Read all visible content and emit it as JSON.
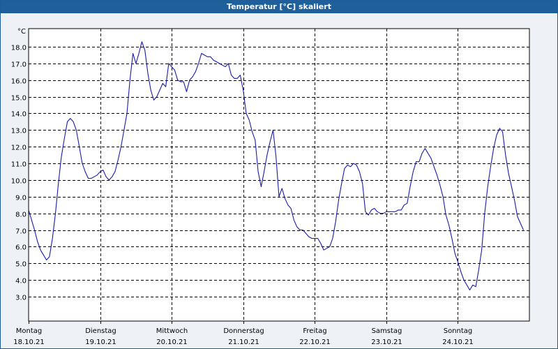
{
  "window": {
    "title": "Temperatur [°C] skaliert"
  },
  "colors": {
    "title_bg": "#1f5f9a",
    "plot_bg": "#ffffff",
    "series": "#1a1aa8",
    "grid": "#000000"
  },
  "chart_data": {
    "type": "line",
    "title": "Temperatur [°C] skaliert",
    "ylabel": "°C",
    "xlabel": "",
    "ylim": [
      2.5,
      18.8
    ],
    "xlim": [
      0,
      168
    ],
    "grid": true,
    "y_ticks": [
      "3.0",
      "4.0",
      "5.0",
      "6.0",
      "7.0",
      "8.0",
      "9.0",
      "10.0",
      "11.0",
      "12.0",
      "13.0",
      "14.0",
      "15.0",
      "16.0",
      "17.0",
      "18.0"
    ],
    "x_ticks": [
      {
        "day": "Montag",
        "date": "18.10.21",
        "x": 0
      },
      {
        "day": "Dienstag",
        "date": "19.10.21",
        "x": 24
      },
      {
        "day": "Mittwoch",
        "date": "20.10.21",
        "x": 48
      },
      {
        "day": "Donnerstag",
        "date": "21.10.21",
        "x": 72
      },
      {
        "day": "Freitag",
        "date": "22.10.21",
        "x": 96
      },
      {
        "day": "Samstag",
        "date": "23.10.21",
        "x": 120
      },
      {
        "day": "Sonntag",
        "date": "24.10.21",
        "x": 144
      }
    ],
    "series": [
      {
        "values": [
          [
            0.0,
            8.2
          ],
          [
            1.0,
            7.6
          ],
          [
            2.0,
            7.0
          ],
          [
            3.0,
            6.3
          ],
          [
            4.0,
            5.8
          ],
          [
            5.0,
            5.5
          ],
          [
            6.0,
            5.2
          ],
          [
            7.0,
            5.4
          ],
          [
            8.0,
            6.5
          ],
          [
            9.0,
            8.0
          ],
          [
            10.0,
            9.8
          ],
          [
            11.0,
            11.4
          ],
          [
            12.0,
            12.5
          ],
          [
            13.0,
            13.5
          ],
          [
            14.0,
            13.7
          ],
          [
            15.0,
            13.5
          ],
          [
            16.0,
            13.0
          ],
          [
            17.0,
            12.0
          ],
          [
            18.0,
            11.0
          ],
          [
            19.0,
            10.5
          ],
          [
            20.0,
            10.1
          ],
          [
            21.0,
            10.1
          ],
          [
            22.0,
            10.2
          ],
          [
            23.0,
            10.3
          ],
          [
            24.0,
            10.5
          ],
          [
            25.0,
            10.6
          ],
          [
            26.0,
            10.2
          ],
          [
            27.0,
            10.0
          ],
          [
            28.0,
            10.2
          ],
          [
            29.0,
            10.5
          ],
          [
            30.0,
            11.2
          ],
          [
            31.0,
            12.0
          ],
          [
            32.0,
            13.0
          ],
          [
            33.0,
            14.0
          ],
          [
            34.0,
            16.0
          ],
          [
            35.0,
            17.6
          ],
          [
            36.0,
            17.0
          ],
          [
            37.0,
            17.6
          ],
          [
            38.0,
            18.3
          ],
          [
            39.0,
            17.8
          ],
          [
            40.0,
            16.4
          ],
          [
            41.0,
            15.4
          ],
          [
            42.0,
            14.8
          ],
          [
            43.0,
            15.0
          ],
          [
            44.0,
            15.4
          ],
          [
            45.0,
            15.8
          ],
          [
            46.0,
            15.6
          ],
          [
            47.0,
            17.0
          ],
          [
            48.0,
            16.8
          ],
          [
            49.0,
            16.6
          ],
          [
            50.0,
            16.0
          ],
          [
            51.0,
            15.9
          ],
          [
            52.0,
            15.9
          ],
          [
            53.0,
            15.3
          ],
          [
            54.0,
            16.0
          ],
          [
            55.0,
            16.2
          ],
          [
            56.0,
            16.5
          ],
          [
            57.0,
            17.0
          ],
          [
            58.0,
            17.6
          ],
          [
            59.0,
            17.5
          ],
          [
            60.0,
            17.4
          ],
          [
            61.0,
            17.4
          ],
          [
            62.0,
            17.2
          ],
          [
            63.0,
            17.1
          ],
          [
            64.0,
            17.0
          ],
          [
            65.0,
            16.9
          ],
          [
            66.0,
            16.8
          ],
          [
            67.0,
            17.0
          ],
          [
            68.0,
            16.3
          ],
          [
            69.0,
            16.1
          ],
          [
            70.0,
            16.1
          ],
          [
            71.0,
            16.3
          ],
          [
            72.0,
            15.4
          ],
          [
            73.0,
            14.0
          ],
          [
            74.0,
            13.6
          ],
          [
            75.0,
            12.9
          ],
          [
            76.0,
            12.4
          ],
          [
            77.0,
            10.5
          ],
          [
            78.0,
            9.6
          ],
          [
            79.0,
            10.5
          ],
          [
            80.0,
            11.5
          ],
          [
            81.0,
            12.3
          ],
          [
            82.0,
            13.0
          ],
          [
            83.0,
            11.4
          ],
          [
            84.0,
            9.0
          ],
          [
            85.0,
            9.5
          ],
          [
            86.0,
            8.9
          ],
          [
            87.0,
            8.5
          ],
          [
            88.0,
            8.3
          ],
          [
            89.0,
            7.6
          ],
          [
            90.0,
            7.2
          ],
          [
            91.0,
            7.0
          ],
          [
            92.0,
            7.0
          ],
          [
            93.0,
            6.8
          ],
          [
            94.0,
            6.6
          ],
          [
            95.0,
            6.5
          ],
          [
            96.0,
            6.5
          ],
          [
            97.0,
            6.5
          ],
          [
            98.0,
            6.2
          ],
          [
            99.0,
            5.8
          ],
          [
            100.0,
            5.9
          ],
          [
            101.0,
            6.0
          ],
          [
            102.0,
            6.5
          ],
          [
            103.0,
            7.5
          ],
          [
            104.0,
            8.8
          ],
          [
            105.0,
            9.8
          ],
          [
            106.0,
            10.7
          ],
          [
            107.0,
            10.9
          ],
          [
            108.0,
            10.8
          ],
          [
            109.0,
            11.0
          ],
          [
            110.0,
            10.9
          ],
          [
            111.0,
            10.5
          ],
          [
            112.0,
            9.8
          ],
          [
            113.0,
            8.1
          ],
          [
            114.0,
            7.9
          ],
          [
            115.0,
            8.2
          ],
          [
            116.0,
            8.3
          ],
          [
            117.0,
            8.1
          ],
          [
            118.0,
            8.0
          ],
          [
            119.0,
            8.0
          ],
          [
            120.0,
            8.1
          ],
          [
            121.0,
            8.1
          ],
          [
            122.0,
            8.1
          ],
          [
            123.0,
            8.1
          ],
          [
            124.0,
            8.2
          ],
          [
            125.0,
            8.2
          ],
          [
            126.0,
            8.5
          ],
          [
            127.0,
            8.6
          ],
          [
            128.0,
            9.6
          ],
          [
            129.0,
            10.5
          ],
          [
            130.0,
            11.1
          ],
          [
            131.0,
            11.1
          ],
          [
            132.0,
            11.6
          ],
          [
            133.0,
            11.9
          ],
          [
            134.0,
            11.6
          ],
          [
            135.0,
            11.3
          ],
          [
            136.0,
            10.8
          ],
          [
            137.0,
            10.3
          ],
          [
            138.0,
            9.7
          ],
          [
            139.0,
            9.0
          ],
          [
            140.0,
            7.9
          ],
          [
            141.0,
            7.3
          ],
          [
            142.0,
            6.5
          ],
          [
            143.0,
            5.6
          ],
          [
            144.0,
            5.1
          ],
          [
            145.0,
            4.5
          ],
          [
            146.0,
            4.0
          ],
          [
            147.0,
            3.7
          ],
          [
            148.0,
            3.4
          ],
          [
            149.0,
            3.7
          ],
          [
            150.0,
            3.6
          ],
          [
            151.0,
            4.6
          ],
          [
            152.0,
            5.8
          ],
          [
            153.0,
            8.0
          ],
          [
            154.0,
            9.6
          ],
          [
            155.0,
            10.8
          ],
          [
            156.0,
            11.9
          ],
          [
            157.0,
            12.7
          ],
          [
            158.0,
            13.1
          ],
          [
            159.0,
            12.9
          ],
          [
            160.0,
            11.5
          ],
          [
            161.0,
            10.4
          ],
          [
            162.0,
            9.6
          ],
          [
            163.0,
            8.8
          ],
          [
            164.0,
            7.8
          ],
          [
            165.0,
            7.4
          ],
          [
            166.0,
            7.0
          ]
        ]
      }
    ]
  }
}
